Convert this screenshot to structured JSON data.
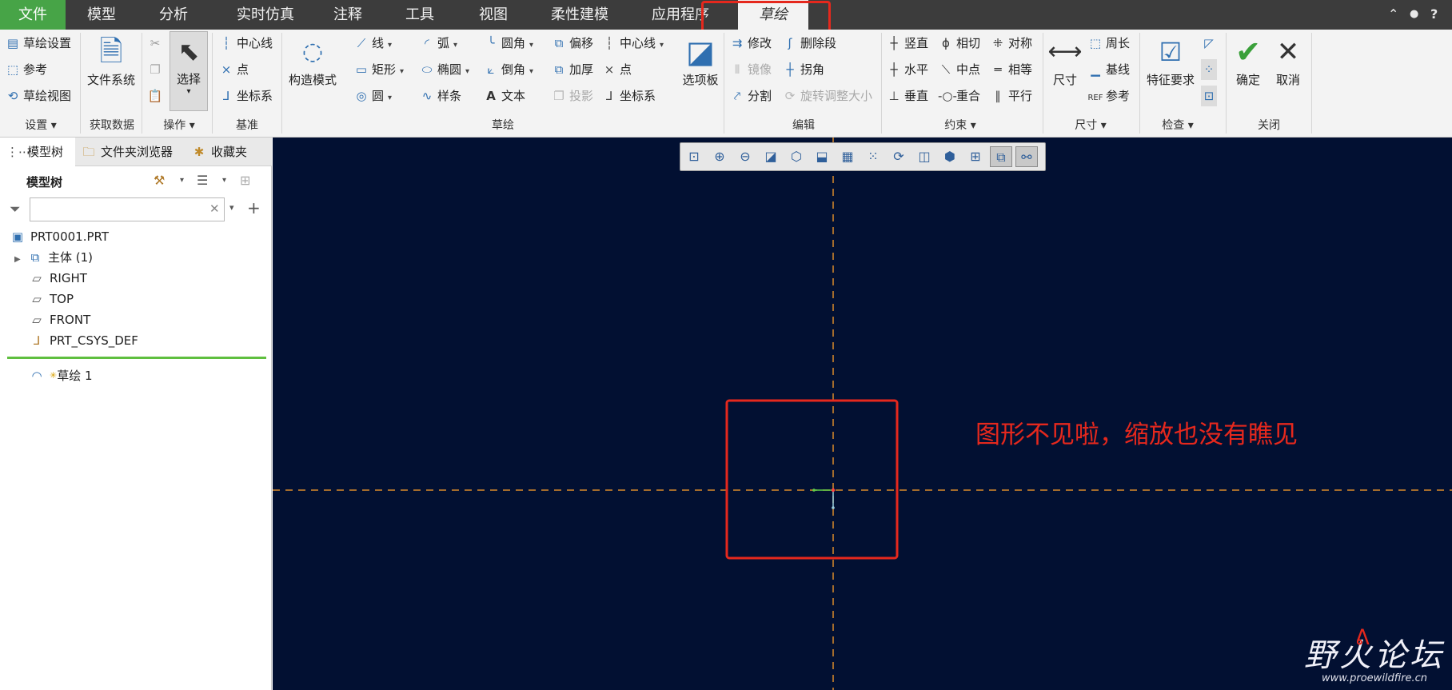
{
  "menubar": {
    "tabs": [
      "文件",
      "模型",
      "分析",
      "实时仿真",
      "注释",
      "工具",
      "视图",
      "柔性建模",
      "应用程序",
      "草绘"
    ],
    "win_controls": [
      "⌃",
      "●",
      "?"
    ]
  },
  "ribbon": {
    "setup": {
      "items": [
        "草绘设置",
        "参考",
        "草绘视图"
      ],
      "label": "设置 ▾"
    },
    "getdata": {
      "big": "文件系统",
      "label": "获取数据"
    },
    "operations": {
      "big": "选择",
      "label": "操作 ▾"
    },
    "datum": {
      "items": [
        "中心线",
        "点",
        "坐标系"
      ],
      "label": "基准"
    },
    "sketching": {
      "construct": "构造模式",
      "col1": [
        "线",
        "矩形",
        "圆"
      ],
      "col2": [
        "弧",
        "椭圆",
        "样条"
      ],
      "col3": [
        "圆角",
        "倒角",
        "文本"
      ],
      "col4": [
        "偏移",
        "加厚",
        "投影"
      ],
      "col5": [
        "中心线",
        "点",
        "坐标系"
      ],
      "palette": "选项板",
      "label": "草绘"
    },
    "editing": {
      "col1": [
        "修改",
        "镜像",
        "分割"
      ],
      "col2": [
        "删除段",
        "拐角",
        "旋转调整大小"
      ],
      "label": "编辑"
    },
    "constrain": {
      "col1": [
        "竖直",
        "水平",
        "垂直"
      ],
      "col2": [
        "相切",
        "中点",
        "重合"
      ],
      "col3": [
        "对称",
        "相等",
        "平行"
      ],
      "label": "约束 ▾"
    },
    "dimension": {
      "big": "尺寸",
      "items": [
        "周长",
        "基线",
        "参考"
      ],
      "label": "尺寸 ▾"
    },
    "inspect": {
      "big": "特征要求",
      "label": "检查 ▾"
    },
    "close": {
      "ok": "确定",
      "cancel": "取消",
      "label": "关闭"
    }
  },
  "left_panel": {
    "tabs": [
      "模型树",
      "文件夹浏览器",
      "收藏夹"
    ],
    "tree_title": "模型树",
    "search": {
      "value": "",
      "placeholder": ""
    },
    "tree_items": [
      "PRT0001.PRT",
      "主体 (1)",
      "RIGHT",
      "TOP",
      "FRONT",
      "PRT_CSYS_DEF",
      "草绘 1"
    ]
  },
  "canvas": {
    "annotation": "图形不见啦，缩放也没有瞧见",
    "watermark_logo": "野火论坛",
    "watermark_url": "www.proewildfire.cn"
  },
  "colors": {
    "menubar_bg": "#3c3c3c",
    "file_tab": "#47a447",
    "canvas_bg": "#021032",
    "annotation_red": "#e5281d",
    "axis_orange": "#d98a2b"
  }
}
